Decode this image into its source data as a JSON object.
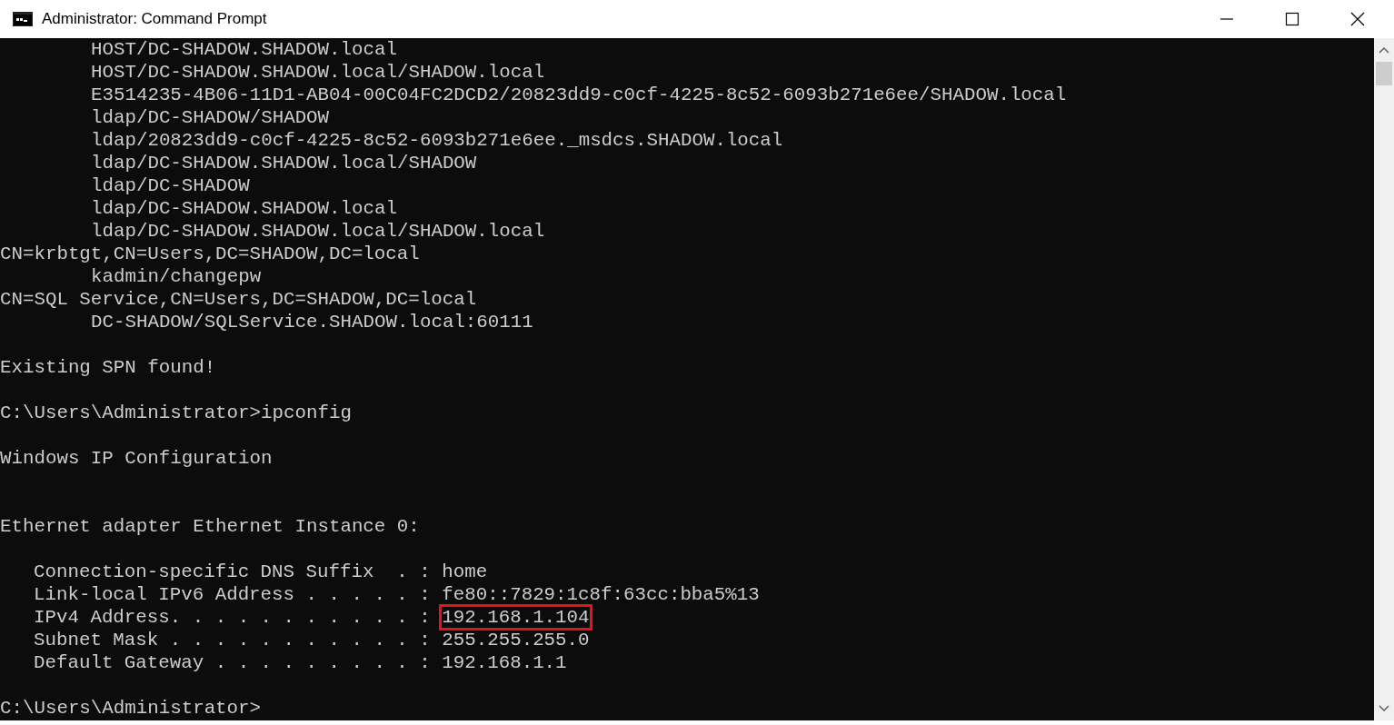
{
  "window": {
    "title": "Administrator: Command Prompt"
  },
  "console": {
    "lines": [
      {
        "kind": "spn",
        "text": "HOST/DC-SHADOW.SHADOW.local"
      },
      {
        "kind": "spn",
        "text": "HOST/DC-SHADOW.SHADOW.local/SHADOW.local"
      },
      {
        "kind": "spn",
        "text": "E3514235-4B06-11D1-AB04-00C04FC2DCD2/20823dd9-c0cf-4225-8c52-6093b271e6ee/SHADOW.local"
      },
      {
        "kind": "spn",
        "text": "ldap/DC-SHADOW/SHADOW"
      },
      {
        "kind": "spn",
        "text": "ldap/20823dd9-c0cf-4225-8c52-6093b271e6ee._msdcs.SHADOW.local"
      },
      {
        "kind": "spn",
        "text": "ldap/DC-SHADOW.SHADOW.local/SHADOW"
      },
      {
        "kind": "spn",
        "text": "ldap/DC-SHADOW"
      },
      {
        "kind": "spn",
        "text": "ldap/DC-SHADOW.SHADOW.local"
      },
      {
        "kind": "spn",
        "text": "ldap/DC-SHADOW.SHADOW.local/SHADOW.local"
      },
      {
        "kind": "text",
        "text": "CN=krbtgt,CN=Users,DC=SHADOW,DC=local"
      },
      {
        "kind": "spn",
        "text": "kadmin/changepw"
      },
      {
        "kind": "text",
        "text": "CN=SQL Service,CN=Users,DC=SHADOW,DC=local"
      },
      {
        "kind": "spn",
        "text": "DC-SHADOW/SQLService.SHADOW.local:60111"
      },
      {
        "kind": "blank"
      },
      {
        "kind": "text",
        "text": "Existing SPN found!"
      },
      {
        "kind": "blank"
      },
      {
        "kind": "text",
        "text": "C:\\Users\\Administrator>ipconfig"
      },
      {
        "kind": "blank"
      },
      {
        "kind": "text",
        "text": "Windows IP Configuration"
      },
      {
        "kind": "blank"
      },
      {
        "kind": "blank"
      },
      {
        "kind": "text",
        "text": "Ethernet adapter Ethernet Instance 0:"
      },
      {
        "kind": "blank"
      },
      {
        "kind": "field",
        "label": "Connection-specific DNS Suffix  . :",
        "value": "home",
        "highlighted": false
      },
      {
        "kind": "field",
        "label": "Link-local IPv6 Address . . . . . :",
        "value": "fe80::7829:1c8f:63cc:bba5%13",
        "highlighted": false
      },
      {
        "kind": "field",
        "label": "IPv4 Address. . . . . . . . . . . :",
        "value": "192.168.1.104",
        "highlighted": true
      },
      {
        "kind": "field",
        "label": "Subnet Mask . . . . . . . . . . . :",
        "value": "255.255.255.0",
        "highlighted": false
      },
      {
        "kind": "field",
        "label": "Default Gateway . . . . . . . . . :",
        "value": "192.168.1.1",
        "highlighted": false
      },
      {
        "kind": "blank"
      },
      {
        "kind": "text",
        "text": "C:\\Users\\Administrator>"
      }
    ]
  }
}
